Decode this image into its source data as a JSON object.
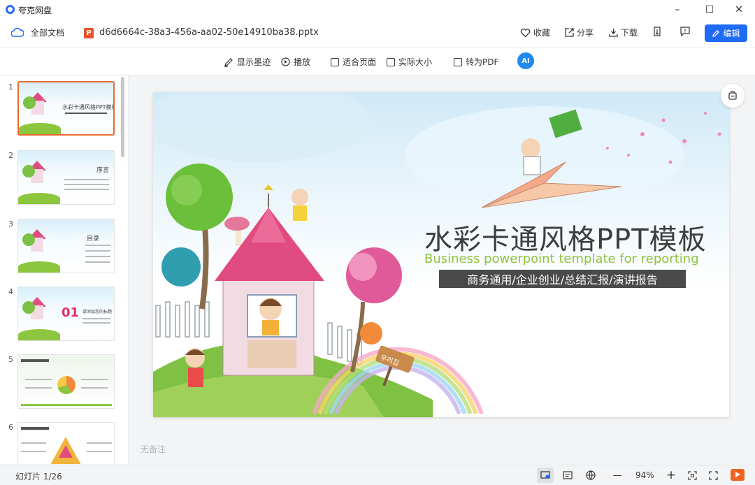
{
  "window": {
    "app_name": "夸克网盘",
    "minimize": "–",
    "maximize": "☐",
    "close": "✕"
  },
  "header": {
    "all_docs": "全部文档",
    "file_name": "d6d6664c-38a3-456a-aa02-50e14910ba38.pptx",
    "ppt_badge": "P",
    "favorite": "收藏",
    "share": "分享",
    "download": "下载",
    "edit": "编辑"
  },
  "toolbar": {
    "show_ink": "显示墨迹",
    "play": "播放",
    "fit_page": "适合页面",
    "actual_size": "实际大小",
    "to_pdf": "转为PDF",
    "ai_label": "AI"
  },
  "sidebar": {
    "thumbnails": [
      {
        "num": "1",
        "title": "水彩卡通风格PPT模板"
      },
      {
        "num": "2",
        "title": "序言"
      },
      {
        "num": "3",
        "title": "目录"
      },
      {
        "num": "4",
        "title": "请添加您的标题",
        "big": "01"
      },
      {
        "num": "5",
        "title": ""
      },
      {
        "num": "6",
        "title": ""
      }
    ]
  },
  "slide": {
    "title": "水彩卡通风格PPT模板",
    "subtitle": "Business powerpoint template for reporting",
    "tagline": "商务通用/企业创业/总结汇报/演讲报告",
    "sign_text": "우리집"
  },
  "notes": {
    "placeholder": "无备注"
  },
  "status": {
    "slide_counter": "幻灯片 1/26",
    "zoom": "94%",
    "zoom_out": "—",
    "zoom_in": "+"
  },
  "colors": {
    "accent": "#1f6bf5",
    "active_thumb_border": "#e76b2f",
    "subtitle_green": "#8fc43d",
    "play_orange": "#f06423"
  }
}
